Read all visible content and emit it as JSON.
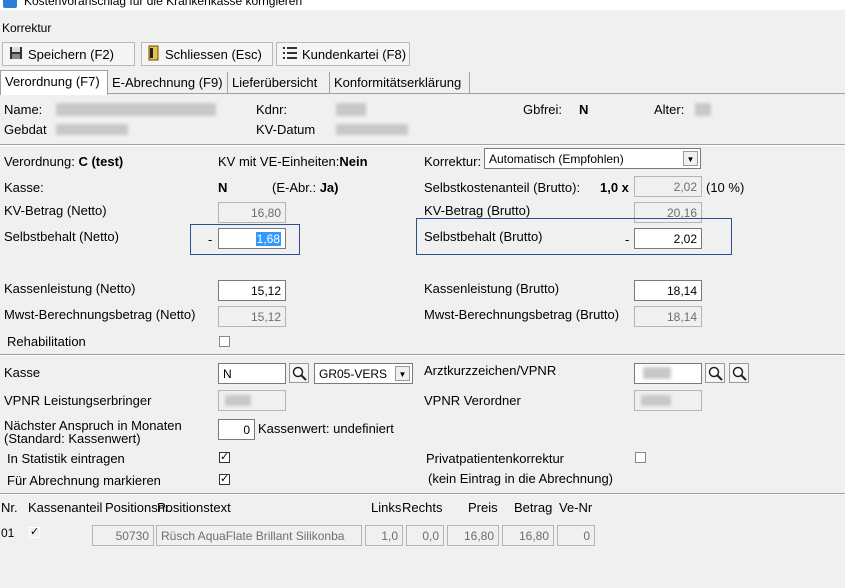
{
  "window": {
    "title": "Kostenvoranschlag für die Krankenkasse korrigieren"
  },
  "menu": {
    "korrektur": "Korrektur"
  },
  "toolbar": {
    "save": "Speichern (F2)",
    "close": "Schliessen (Esc)",
    "kundenkartei": "Kundenkartei (F8)"
  },
  "tabs": [
    "Verordnung (F7)",
    "E-Abrechnung (F9)",
    "Lieferübersicht",
    "Konformitätserklärung"
  ],
  "patient": {
    "name_label": "Name:",
    "gebdat_label": "Gebdat",
    "kdnr_label": "Kdnr:",
    "kvdatum_label": "KV-Datum",
    "gbfrei_label": "Gbfrei:",
    "gbfrei_value": "N",
    "alter_label": "Alter:"
  },
  "verordnung": {
    "label": "Verordnung:",
    "value": "C (test)",
    "kv_ve_label": "KV mit VE-Einheiten:",
    "kv_ve_value": "Nein",
    "korrektur_label": "Korrektur:",
    "korrektur_value": "Automatisch (Empfohlen)",
    "kasse_label": "Kasse:",
    "kasse_value": "N",
    "eabr_label": "(E-Abr.:",
    "eabr_value": "Ja)",
    "selbstkostenanteil_label": "Selbstkostenanteil (Brutto):",
    "selbstkostenanteil_factor": "1,0 x",
    "selbstkostenanteil_value": "2,02",
    "selbstkostenanteil_pct": "(10 %)",
    "kv_betrag_netto_label": "KV-Betrag (Netto)",
    "kv_betrag_netto": "16,80",
    "kv_betrag_brutto_label": "KV-Betrag (Brutto)",
    "kv_betrag_brutto": "20,16",
    "selbstbehalt_netto_label": "Selbstbehalt (Netto)",
    "selbstbehalt_netto": "1,68",
    "selbstbehalt_brutto_label": "Selbstbehalt (Brutto)",
    "selbstbehalt_brutto": "2,02",
    "minus": "-",
    "kassenleistung_netto_label": "Kassenleistung (Netto)",
    "kassenleistung_netto": "15,12",
    "kassenleistung_brutto_label": "Kassenleistung (Brutto)",
    "kassenleistung_brutto": "18,14",
    "mwst_netto_label": "Mwst-Berechnungsbetrag (Netto)",
    "mwst_netto": "15,12",
    "mwst_brutto_label": "Mwst-Berechnungsbetrag (Brutto)",
    "mwst_brutto": "18,14",
    "rehabilitation_label": "Rehabilitation"
  },
  "kasse_section": {
    "kasse_label": "Kasse",
    "kasse_value": "N",
    "kasse_select": "GR05-VERS",
    "arzt_label": "Arztkurzzeichen/VPNR",
    "vpnr_le_label": "VPNR Leistungserbringer",
    "vpnr_verordner_label": "VPNR Verordner",
    "naechster_label_1": "Nächster Anspruch in Monaten",
    "naechster_label_2": "(Standard: Kassenwert)",
    "naechster_value": "0",
    "kassenwert_text": "Kassenwert: undefiniert",
    "statistik_label": "In Statistik eintragen",
    "abrechnung_label": "Für Abrechnung markieren",
    "privat_label": "Privatpatientenkorrektur",
    "privat_note": "(kein Eintrag in die Abrechnung)"
  },
  "positions": {
    "headers": [
      "Nr.",
      "Kassenanteil",
      "Positionsnr.",
      "Positionstext",
      "Links",
      "Rechts",
      "Preis",
      "Betrag",
      "Ve-Nr"
    ],
    "rows": [
      {
        "nr": "01",
        "positionsnr": "50730",
        "text": "Rüsch AquaFlate Brillant Silikonba",
        "links": "1,0",
        "rechts": "0,0",
        "preis": "16,80",
        "betrag": "16,80",
        "venr": "0"
      }
    ]
  }
}
